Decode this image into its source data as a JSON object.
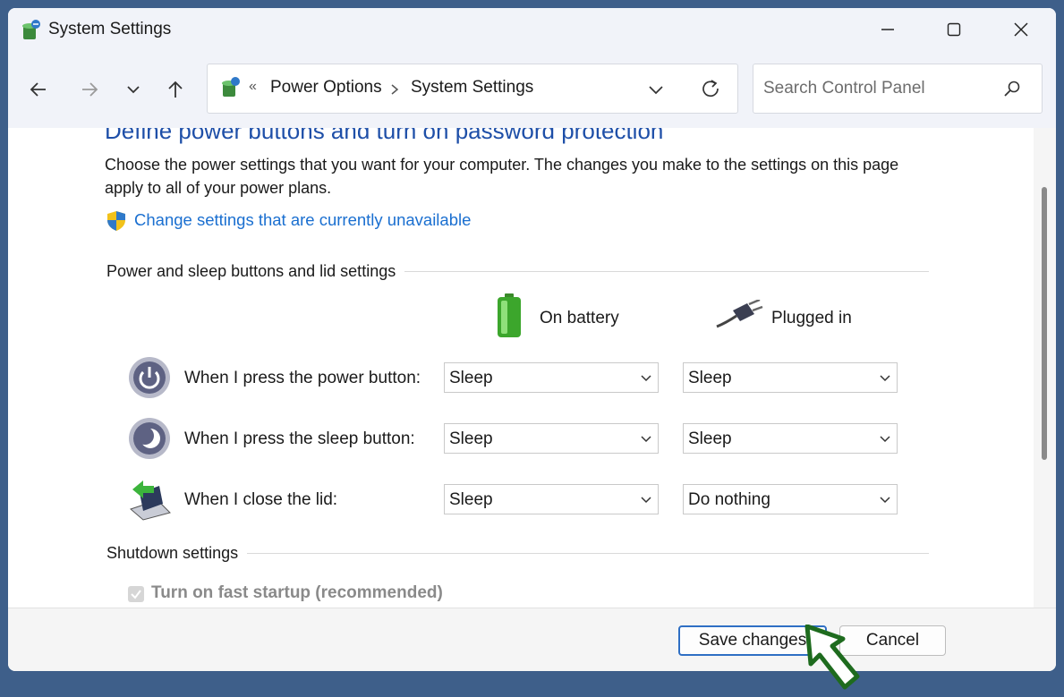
{
  "window": {
    "title": "System Settings",
    "controls": {
      "minimize": "minimize",
      "maximize": "maximize",
      "close": "close"
    }
  },
  "addressbar": {
    "overflow": "«",
    "breadcrumb": [
      "Power Options",
      "System Settings"
    ],
    "search_placeholder": "Search Control Panel"
  },
  "page": {
    "heading": "Define power buttons and turn on password protection",
    "description": "Choose the power settings that you want for your computer. The changes you make to the settings on this page apply to all of your power plans.",
    "change_link": "Change settings that are currently unavailable"
  },
  "power_section": {
    "title": "Power and sleep buttons and lid settings",
    "columns": {
      "on_battery": "On battery",
      "plugged_in": "Plugged in"
    },
    "rows": [
      {
        "label": "When I press the power button:",
        "on_battery": "Sleep",
        "plugged_in": "Sleep",
        "icon": "power-icon"
      },
      {
        "label": "When I press the sleep button:",
        "on_battery": "Sleep",
        "plugged_in": "Sleep",
        "icon": "sleep-moon-icon"
      },
      {
        "label": "When I close the lid:",
        "on_battery": "Sleep",
        "plugged_in": "Do nothing",
        "icon": "laptop-lid-icon"
      }
    ]
  },
  "shutdown_section": {
    "title": "Shutdown settings",
    "fast_startup": {
      "label": "Turn on fast startup (recommended)",
      "checked": true,
      "disabled": true
    }
  },
  "footer": {
    "save": "Save changes",
    "cancel": "Cancel"
  },
  "colors": {
    "heading": "#1e4fa8",
    "link": "#1a6fd0",
    "annotation_arrow": "#1e6b1e",
    "frame": "#3e5f8a"
  }
}
